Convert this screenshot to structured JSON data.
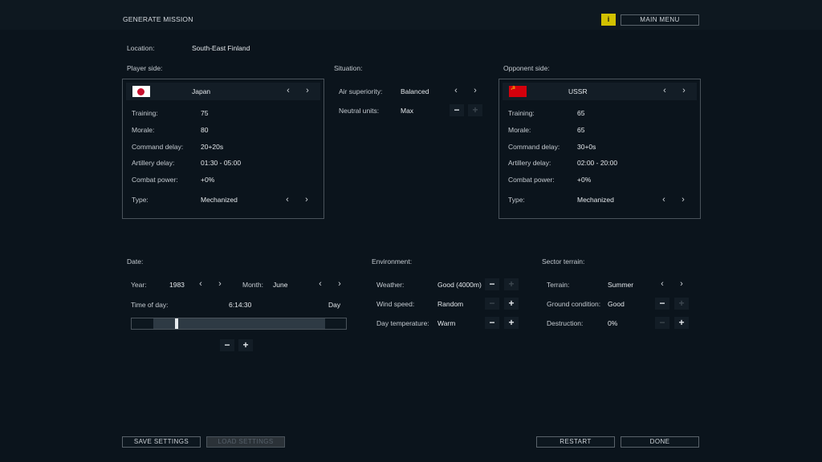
{
  "header": {
    "title": "GENERATE MISSION",
    "info_label": "i",
    "main_menu": "MAIN MENU"
  },
  "location": {
    "label": "Location:",
    "value": "South-East Finland"
  },
  "player": {
    "section_label": "Player side:",
    "country": "Japan",
    "rows": [
      {
        "label": "Training:",
        "value": "75"
      },
      {
        "label": "Morale:",
        "value": "80"
      },
      {
        "label": "Command delay:",
        "value": "20+20s"
      },
      {
        "label": "Artillery delay:",
        "value": "01:30 - 05:00"
      },
      {
        "label": "Combat power:",
        "value": "+0%"
      }
    ],
    "type": {
      "label": "Type:",
      "value": "Mechanized"
    }
  },
  "situation": {
    "section_label": "Situation:",
    "air": {
      "label": "Air superiority:",
      "value": "Balanced"
    },
    "neutral": {
      "label": "Neutral units:",
      "value": "Max"
    }
  },
  "opponent": {
    "section_label": "Opponent side:",
    "country": "USSR",
    "rows": [
      {
        "label": "Training:",
        "value": "65"
      },
      {
        "label": "Morale:",
        "value": "65"
      },
      {
        "label": "Command delay:",
        "value": "30+0s"
      },
      {
        "label": "Artillery delay:",
        "value": "02:00 - 20:00"
      },
      {
        "label": "Combat power:",
        "value": "+0%"
      }
    ],
    "type": {
      "label": "Type:",
      "value": "Mechanized"
    }
  },
  "date": {
    "section_label": "Date:",
    "year_label": "Year:",
    "year": "1983",
    "month_label": "Month:",
    "month": "June",
    "time_label": "Time of day:",
    "time": "6:14:30",
    "period": "Day",
    "time_fraction": 0.26
  },
  "environment": {
    "section_label": "Environment:",
    "weather": {
      "label": "Weather:",
      "value": "Good (4000m)"
    },
    "wind": {
      "label": "Wind speed:",
      "value": "Random"
    },
    "temp": {
      "label": "Day temperature:",
      "value": "Warm"
    }
  },
  "terrain": {
    "section_label": "Sector terrain:",
    "terrain": {
      "label": "Terrain:",
      "value": "Summer"
    },
    "ground": {
      "label": "Ground condition:",
      "value": "Good"
    },
    "destruction": {
      "label": "Destruction:",
      "value": "0%"
    }
  },
  "footer": {
    "save": "SAVE SETTINGS",
    "load": "LOAD SETTINGS",
    "restart": "RESTART",
    "done": "DONE"
  },
  "glyphs": {
    "left": "‹",
    "right": "›",
    "minus": "−",
    "plus": "+"
  },
  "colors": {
    "accent": "#d2c100",
    "background": "#0b141c"
  },
  "icons": {
    "left": "chevron-left-icon",
    "right": "chevron-right-icon"
  }
}
